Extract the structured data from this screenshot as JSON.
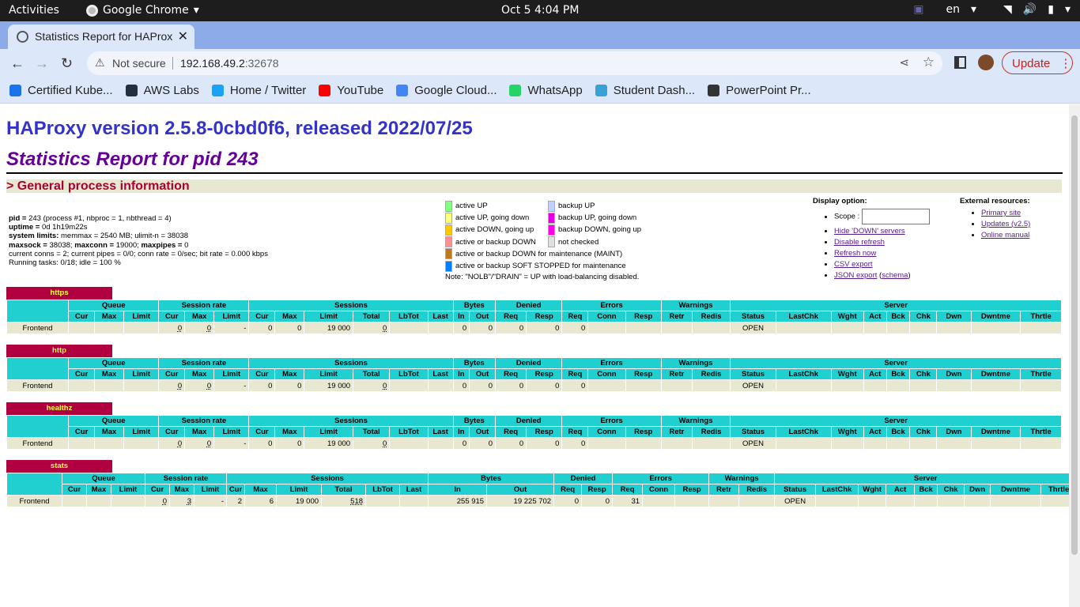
{
  "system": {
    "activities": "Activities",
    "app_name": "Google Chrome",
    "clock": "Oct 5   4:04 PM",
    "lang": "en"
  },
  "browser": {
    "tab_title": "Statistics Report for HAProxy",
    "security_label": "Not secure",
    "url_host": "192.168.49.2",
    "url_port": ":32678",
    "update_label": "Update",
    "bookmarks": [
      {
        "label": "Certified Kube...",
        "color": "#1a73e8"
      },
      {
        "label": "AWS Labs",
        "color": "#232f3e"
      },
      {
        "label": "Home / Twitter",
        "color": "#1da1f2"
      },
      {
        "label": "YouTube",
        "color": "#ff0000"
      },
      {
        "label": "Google Cloud...",
        "color": "#4285f4"
      },
      {
        "label": "WhatsApp",
        "color": "#25d366"
      },
      {
        "label": "Student Dash...",
        "color": "#3aa0d8"
      },
      {
        "label": "PowerPoint Pr...",
        "color": "#333333"
      }
    ]
  },
  "report": {
    "version_title": "HAProxy version 2.5.8-0cbd0f6, released 2022/07/25",
    "stats_title": "Statistics Report for pid 243",
    "section_title": "> General process information",
    "info": {
      "pid_label": "pid = ",
      "pid_value": "243 (process #1, nbproc = 1, nbthread = 4)",
      "uptime_label": "uptime = ",
      "uptime_value": "0d 1h19m22s",
      "limits_label": "system limits:",
      "limits_value": " memmax = 2540 MB; ulimit-n = 38038",
      "maxsock_label": "maxsock = ",
      "maxsock_value": "38038; ",
      "maxconn_label": "maxconn = ",
      "maxconn_value": "19000; ",
      "maxpipes_label": "maxpipes = ",
      "maxpipes_value": "0",
      "current": "current conns = 2; current pipes = 0/0; conn rate = 0/sec; bit rate = 0.000 kbps",
      "tasks": "Running tasks: 0/18; idle = 100 %"
    },
    "legend_left": [
      {
        "label": "active UP",
        "color": "#80ff80"
      },
      {
        "label": "active UP, going down",
        "color": "#ffff80"
      },
      {
        "label": "active DOWN, going up",
        "color": "#ffc800"
      },
      {
        "label": "active or backup DOWN",
        "color": "#ff9090"
      },
      {
        "label": "active or backup DOWN for maintenance (MAINT)",
        "color": "#c07820"
      },
      {
        "label": "active or backup SOFT STOPPED for maintenance",
        "color": "#0080ff"
      }
    ],
    "legend_right": [
      {
        "label": "backup UP",
        "color": "#c0d0ff"
      },
      {
        "label": "backup UP, going down",
        "color": "#e000e0"
      },
      {
        "label": "backup DOWN, going up",
        "color": "#ff00e8"
      },
      {
        "label": "not checked",
        "color": "#e0e0e0"
      }
    ],
    "legend_note": "Note: \"NOLB\"/\"DRAIN\" = UP with load-balancing disabled.",
    "display": {
      "title": "Display option:",
      "scope": "Scope :",
      "hide_down": "Hide 'DOWN' servers",
      "disable_refresh": "Disable refresh",
      "refresh_now": "Refresh now",
      "csv": "CSV export",
      "json": "JSON export",
      "schema": "schema"
    },
    "external": {
      "title": "External resources:",
      "primary": "Primary site",
      "updates": "Updates (v2.5)",
      "manual": "Online manual"
    }
  },
  "table_headers": {
    "groups": [
      "Queue",
      "Session rate",
      "Sessions",
      "Bytes",
      "Denied",
      "Errors",
      "Warnings",
      "Server"
    ],
    "cols": [
      "Cur",
      "Max",
      "Limit",
      "Cur",
      "Max",
      "Limit",
      "Cur",
      "Max",
      "Limit",
      "Total",
      "LbTot",
      "Last",
      "In",
      "Out",
      "Req",
      "Resp",
      "Req",
      "Conn",
      "Resp",
      "Retr",
      "Redis",
      "Status",
      "LastChk",
      "Wght",
      "Act",
      "Bck",
      "Chk",
      "Dwn",
      "Dwntme",
      "Thrtle"
    ]
  },
  "proxies": [
    {
      "name": "https",
      "row": [
        "Frontend",
        "",
        "",
        "",
        "0",
        "0",
        "-",
        "0",
        "0",
        "19 000",
        "0",
        "",
        "",
        "0",
        "0",
        "0",
        "0",
        "0",
        "",
        "",
        "",
        "",
        "OPEN",
        "",
        "",
        "",
        "",
        "",
        "",
        "",
        ""
      ]
    },
    {
      "name": "http",
      "row": [
        "Frontend",
        "",
        "",
        "",
        "0",
        "0",
        "-",
        "0",
        "0",
        "19 000",
        "0",
        "",
        "",
        "0",
        "0",
        "0",
        "0",
        "0",
        "",
        "",
        "",
        "",
        "OPEN",
        "",
        "",
        "",
        "",
        "",
        "",
        "",
        ""
      ]
    },
    {
      "name": "healthz",
      "row": [
        "Frontend",
        "",
        "",
        "",
        "0",
        "0",
        "-",
        "0",
        "0",
        "19 000",
        "0",
        "",
        "",
        "0",
        "0",
        "0",
        "0",
        "0",
        "",
        "",
        "",
        "",
        "OPEN",
        "",
        "",
        "",
        "",
        "",
        "",
        "",
        ""
      ]
    },
    {
      "name": "stats",
      "row": [
        "Frontend",
        "",
        "",
        "",
        "0",
        "3",
        "-",
        "2",
        "6",
        "19 000",
        "518",
        "",
        "",
        "255 915",
        "19 225 702",
        "0",
        "0",
        "31",
        "",
        "",
        "",
        "",
        "OPEN",
        "",
        "",
        "",
        "",
        "",
        "",
        "",
        ""
      ]
    }
  ]
}
